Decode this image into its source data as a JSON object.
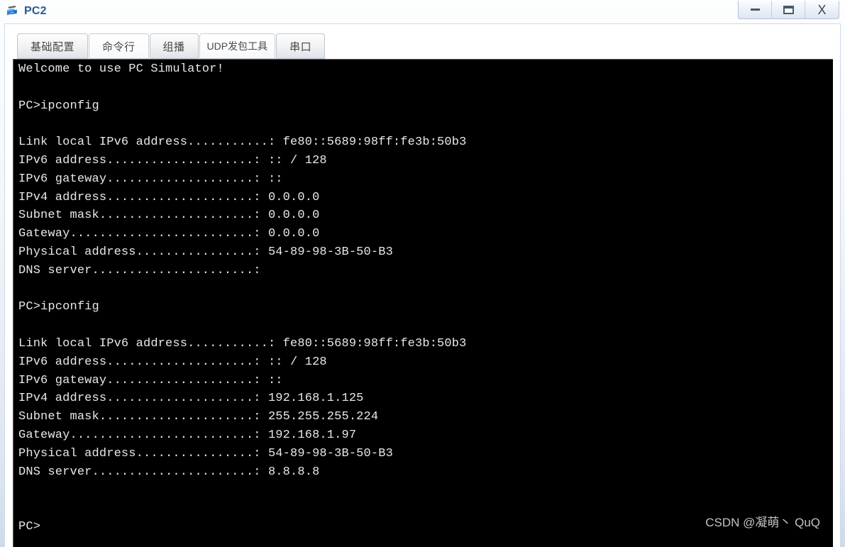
{
  "window": {
    "title": "PC2",
    "icon": "pc-device-icon",
    "controls": [
      {
        "name": "minimize-button",
        "label": "—",
        "glyph": "minimize-icon"
      },
      {
        "name": "maximize-button",
        "label": "□",
        "glyph": "maximize-icon"
      },
      {
        "name": "close-button",
        "label": "X",
        "glyph": "close-icon"
      }
    ]
  },
  "tabs": [
    {
      "id": "basic-config",
      "label": "基础配置",
      "active": false
    },
    {
      "id": "command-line",
      "label": "命令行",
      "active": true
    },
    {
      "id": "multicast",
      "label": "组播",
      "active": false
    },
    {
      "id": "udp-tool",
      "label": "UDP发包工具",
      "active": false
    },
    {
      "id": "serial-port",
      "label": "串口",
      "active": false
    }
  ],
  "terminal": {
    "prompt": "PC>",
    "command": "ipconfig",
    "lines": [
      "Welcome to use PC Simulator!",
      "",
      "PC>ipconfig",
      "",
      "Link local IPv6 address...........: fe80::5689:98ff:fe3b:50b3",
      "IPv6 address....................: :: / 128",
      "IPv6 gateway....................: ::",
      "IPv4 address....................: 0.0.0.0",
      "Subnet mask.....................: 0.0.0.0",
      "Gateway.........................: 0.0.0.0",
      "Physical address................: 54-89-98-3B-50-B3",
      "DNS server......................:",
      "",
      "PC>ipconfig",
      "",
      "Link local IPv6 address...........: fe80::5689:98ff:fe3b:50b3",
      "IPv6 address....................: :: / 128",
      "IPv6 gateway....................: ::",
      "IPv4 address....................: 192.168.1.125",
      "Subnet mask.....................: 255.255.255.224",
      "Gateway.........................: 192.168.1.97",
      "Physical address................: 54-89-98-3B-50-B3",
      "DNS server......................: 8.8.8.8",
      "",
      "",
      "PC>"
    ],
    "blocks": [
      {
        "command": "ipconfig",
        "link_local_ipv6_address": "fe80::5689:98ff:fe3b:50b3",
        "ipv6_address": ":: / 128",
        "ipv6_gateway": "::",
        "ipv4_address": "0.0.0.0",
        "subnet_mask": "0.0.0.0",
        "gateway": "0.0.0.0",
        "physical_address": "54-89-98-3B-50-B3",
        "dns_server": ""
      },
      {
        "command": "ipconfig",
        "link_local_ipv6_address": "fe80::5689:98ff:fe3b:50b3",
        "ipv6_address": ":: / 128",
        "ipv6_gateway": "::",
        "ipv4_address": "192.168.1.125",
        "subnet_mask": "255.255.255.224",
        "gateway": "192.168.1.97",
        "physical_address": "54-89-98-3B-50-B3",
        "dns_server": "8.8.8.8"
      }
    ]
  },
  "watermark": {
    "text": "CSDN @凝萌丶 QuQ"
  },
  "colors": {
    "title_text": "#2b5a94",
    "terminal_bg": "#000000",
    "terminal_text": "#e8e8e8",
    "tab_text": "#474747",
    "watermark_text": "#d4d4d4"
  }
}
